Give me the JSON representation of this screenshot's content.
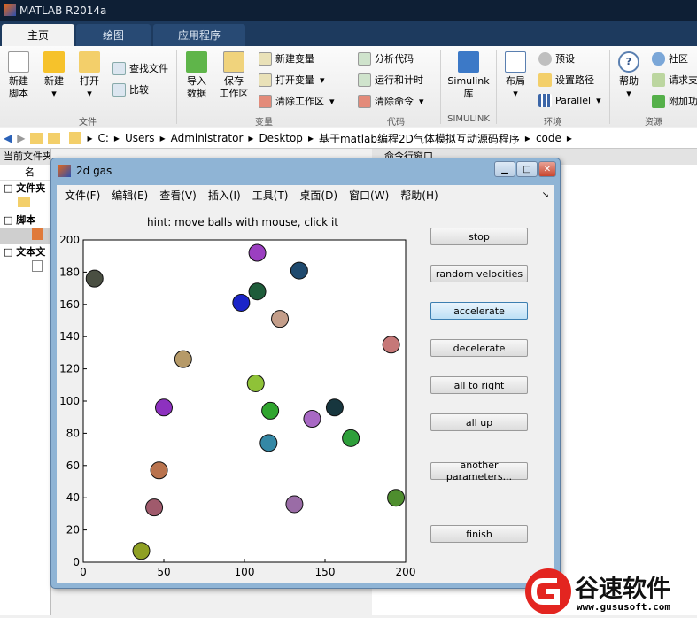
{
  "app": {
    "title": "MATLAB R2014a"
  },
  "tabs": [
    "主页",
    "绘图",
    "应用程序"
  ],
  "ribbon": {
    "new_script": "新建\n脚本",
    "new": "新建",
    "open": "打开",
    "find_files": "查找文件",
    "compare": "比较",
    "import": "导入\n数据",
    "save_ws": "保存\n工作区",
    "new_var": "新建变量",
    "open_var": "打开变量",
    "clear_ws": "清除工作区",
    "analyze": "分析代码",
    "run_time": "运行和计时",
    "clear_cmd": "清除命令",
    "simulink": "Simulink\n库",
    "layout": "布局",
    "prefs": "预设",
    "set_path": "设置路径",
    "parallel": "Parallel",
    "help": "帮助",
    "community": "社区",
    "request": "请求支",
    "addons": "附加功",
    "sect_file": "文件",
    "sect_var": "变量",
    "sect_code": "代码",
    "sect_sim": "SIMULINK",
    "sect_env": "环境",
    "sect_res": "资源"
  },
  "address": [
    "C:",
    "Users",
    "Administrator",
    "Desktop",
    "基于matlab编程2D气体模拟互动源码程序",
    "code"
  ],
  "left_panel": {
    "header": "当前文件夹",
    "name_col": "名",
    "folders": "文件夹",
    "scripts": "脚本",
    "texts": "文本文"
  },
  "right_panel": {
    "header": "命令行窗口"
  },
  "figure": {
    "title": "2d gas",
    "menu": [
      "文件(F)",
      "编辑(E)",
      "查看(V)",
      "插入(I)",
      "工具(T)",
      "桌面(D)",
      "窗口(W)",
      "帮助(H)"
    ],
    "buttons": {
      "stop": "stop",
      "random": "random velocities",
      "accelerate": "accelerate",
      "decelerate": "decelerate",
      "all_right": "all to right",
      "all_up": "all up",
      "another": "another parameters...",
      "finish": "finish"
    }
  },
  "chart_data": {
    "type": "scatter",
    "title": "hint: move balls with mouse, click it",
    "xlim": [
      0,
      200
    ],
    "ylim": [
      0,
      200
    ],
    "xticks": [
      0,
      50,
      100,
      150,
      200
    ],
    "yticks": [
      0,
      20,
      40,
      60,
      80,
      100,
      120,
      140,
      160,
      180,
      200
    ],
    "points": [
      {
        "x": 7,
        "y": 176,
        "color": "#4a4f42"
      },
      {
        "x": 108,
        "y": 192,
        "color": "#9b3fc1"
      },
      {
        "x": 134,
        "y": 181,
        "color": "#1f4a6e"
      },
      {
        "x": 108,
        "y": 168,
        "color": "#1e5c3a"
      },
      {
        "x": 98,
        "y": 161,
        "color": "#1a24c8"
      },
      {
        "x": 122,
        "y": 151,
        "color": "#c49e8a"
      },
      {
        "x": 191,
        "y": 135,
        "color": "#c67878"
      },
      {
        "x": 62,
        "y": 126,
        "color": "#b69a68"
      },
      {
        "x": 107,
        "y": 111,
        "color": "#8fc238"
      },
      {
        "x": 50,
        "y": 96,
        "color": "#8d31bf"
      },
      {
        "x": 116,
        "y": 94,
        "color": "#30a52f"
      },
      {
        "x": 156,
        "y": 96,
        "color": "#17363e"
      },
      {
        "x": 142,
        "y": 89,
        "color": "#a868c4"
      },
      {
        "x": 166,
        "y": 77,
        "color": "#2e9f3a"
      },
      {
        "x": 115,
        "y": 74,
        "color": "#3588a5"
      },
      {
        "x": 47,
        "y": 57,
        "color": "#b9734e"
      },
      {
        "x": 44,
        "y": 34,
        "color": "#a05a6c"
      },
      {
        "x": 131,
        "y": 36,
        "color": "#9a6ca6"
      },
      {
        "x": 194,
        "y": 40,
        "color": "#4e8e2e"
      },
      {
        "x": 36,
        "y": 7,
        "color": "#8fa024"
      }
    ]
  },
  "watermark": {
    "name": "谷速软件",
    "url": "www.gususoft.com"
  }
}
